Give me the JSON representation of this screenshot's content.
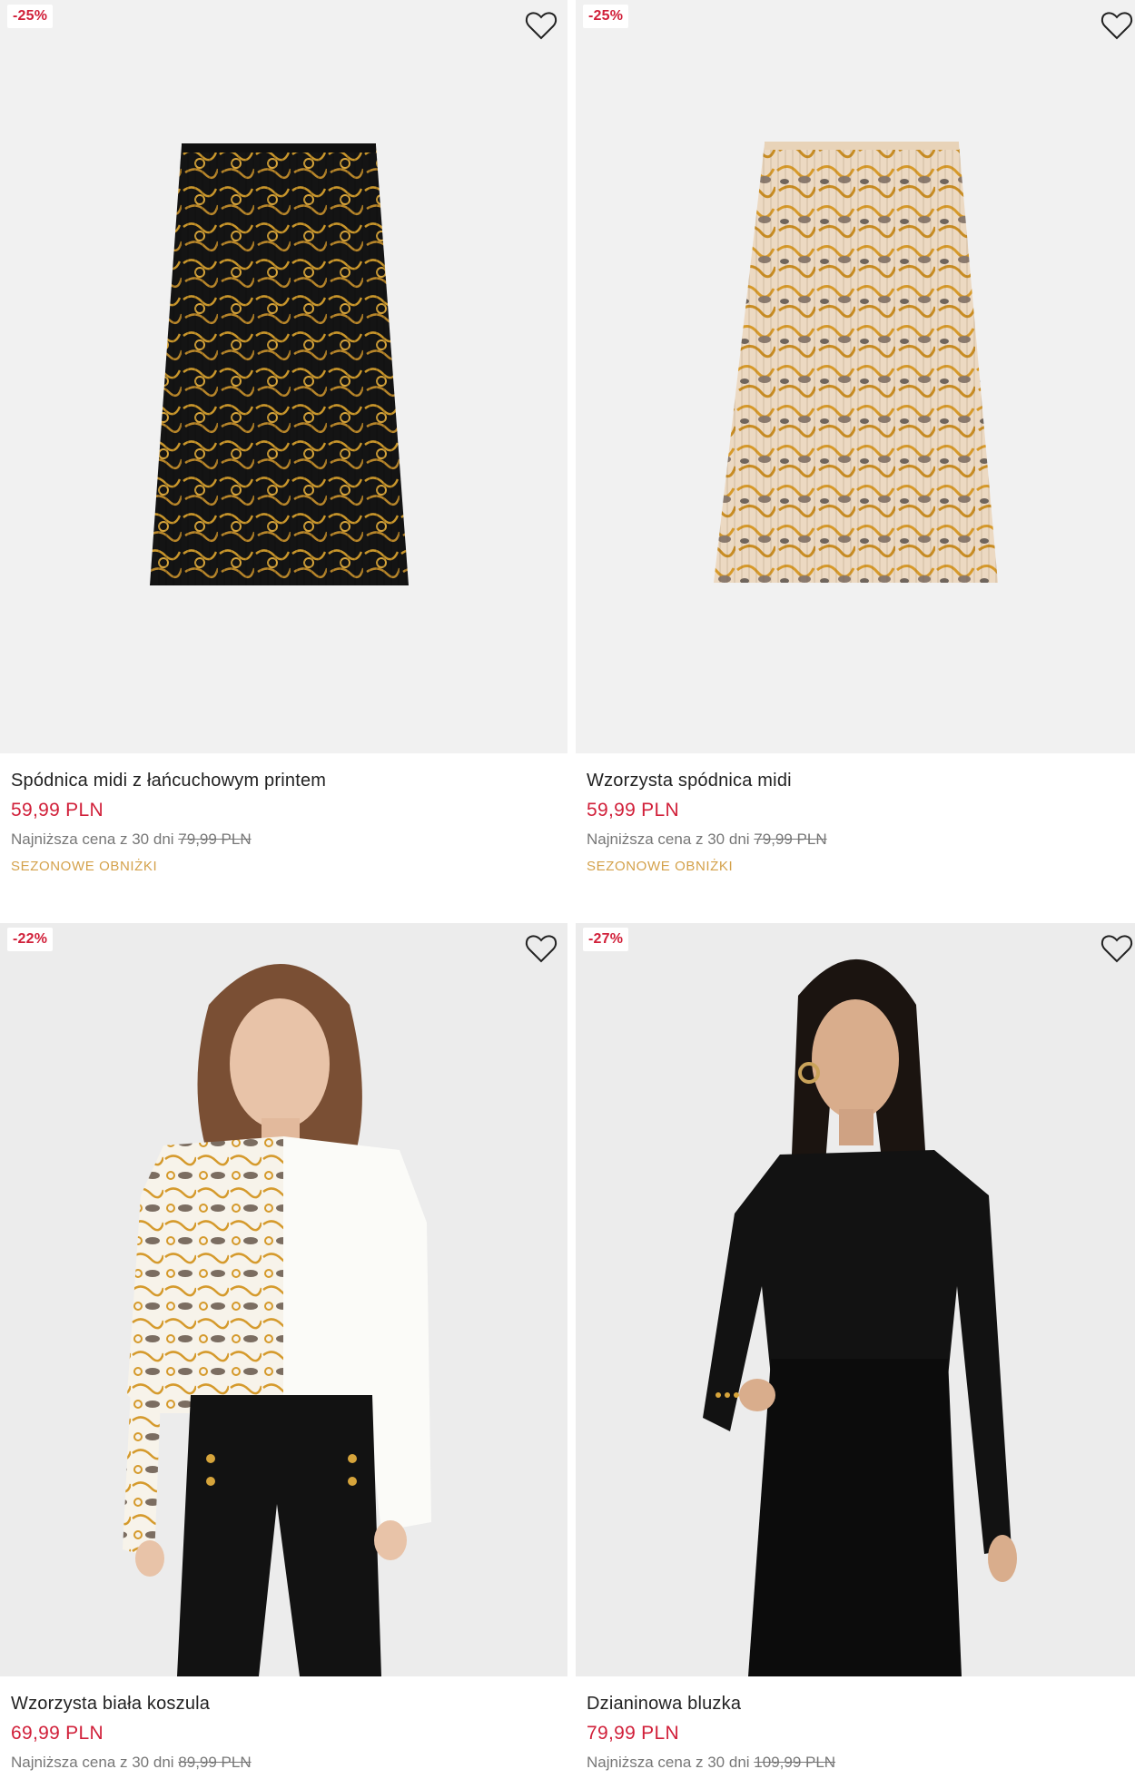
{
  "products": [
    {
      "discount": "-25%",
      "name": "Spódnica midi z łańcuchowym printem",
      "price": "59,99 PLN",
      "lowest_label": "Najniższa cena z 30 dni",
      "lowest_price": "79,99 PLN",
      "promo": "SEZONOWE OBNIŻKI",
      "image": "black-gold-chain-pleated-skirt"
    },
    {
      "discount": "-25%",
      "name": "Wzorzysta spódnica midi",
      "price": "59,99 PLN",
      "lowest_label": "Najniższa cena z 30 dni",
      "lowest_price": "79,99 PLN",
      "promo": "SEZONOWE OBNIŻKI",
      "image": "beige-snake-chain-pleated-skirt"
    },
    {
      "discount": "-22%",
      "name": "Wzorzysta biała koszula",
      "price": "69,99 PLN",
      "lowest_label": "Najniższa cena z 30 dni",
      "lowest_price": "89,99 PLN",
      "image": "model-white-patterned-shirt"
    },
    {
      "discount": "-27%",
      "name": "Dzianinowa bluzka",
      "price": "79,99 PLN",
      "lowest_label": "Najniższa cena z 30 dni",
      "lowest_price": "109,99 PLN",
      "image": "model-black-knit-top"
    }
  ],
  "icons": {
    "favorite": "heart-outline-icon"
  },
  "colors": {
    "price": "#d1203a",
    "promo": "#d4a14a",
    "badge_text": "#d1203a",
    "image_bg": "#f1f1f1"
  }
}
